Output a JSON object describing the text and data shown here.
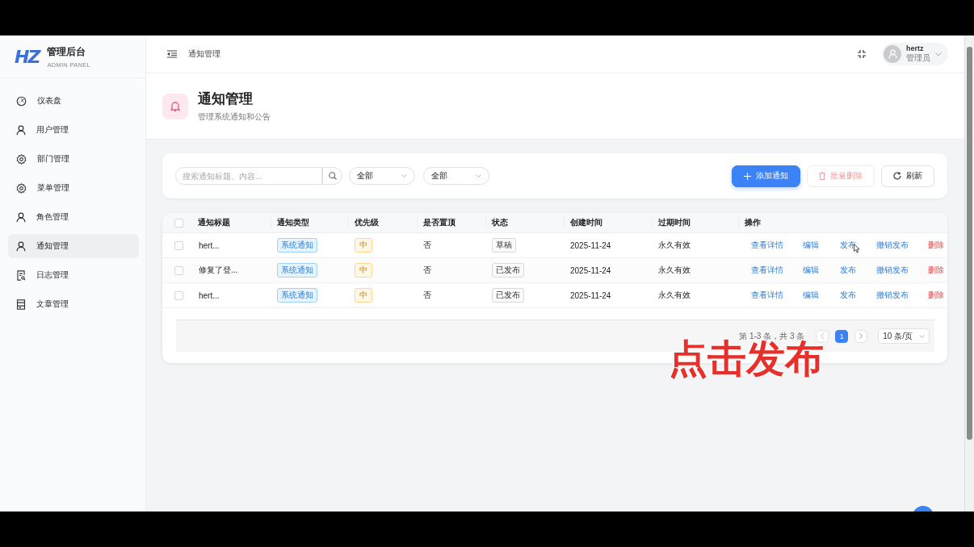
{
  "brand": {
    "logo": "HZ",
    "title": "管理后台",
    "subtitle": "ADMIN PANEL"
  },
  "sidebar": {
    "items": [
      {
        "label": "仪表盘",
        "kind": "dashboard",
        "selected": false
      },
      {
        "label": "用户管理",
        "kind": "user",
        "selected": false
      },
      {
        "label": "部门管理",
        "kind": "gear",
        "selected": false
      },
      {
        "label": "菜单管理",
        "kind": "gear",
        "selected": false
      },
      {
        "label": "角色管理",
        "kind": "user",
        "selected": false
      },
      {
        "label": "通知管理",
        "kind": "user",
        "selected": true
      },
      {
        "label": "日志管理",
        "kind": "log",
        "selected": false
      },
      {
        "label": "文章管理",
        "kind": "article",
        "selected": false
      }
    ]
  },
  "header": {
    "breadcrumb": "通知管理",
    "user": {
      "name": "hertz",
      "role": "管理员"
    }
  },
  "page": {
    "title": "通知管理",
    "subtitle": "管理系统通知和公告"
  },
  "toolbar": {
    "search": {
      "placeholder": "搜索通知标题、内容..."
    },
    "filters": [
      {
        "value": "全部"
      },
      {
        "value": "全部"
      }
    ],
    "buttons": [
      {
        "label": "添加通知",
        "kind": "primary",
        "disabled": false
      },
      {
        "label": "批量删除",
        "kind": "danger",
        "disabled": true
      },
      {
        "label": "刷新",
        "kind": "default",
        "disabled": false
      }
    ]
  },
  "table": {
    "select_all_checked": false,
    "columns": [
      "通知标题",
      "通知类型",
      "优先级",
      "是否置顶",
      "状态",
      "创建时间",
      "过期时间",
      "操作"
    ],
    "rows": [
      {
        "checked": false,
        "title": "hert...",
        "type": "系统通知",
        "priority": "中",
        "pinned": "否",
        "status": "草稿",
        "created": "2025-11-24",
        "expires": "永久有效",
        "actions": [
          {
            "label": "查看详情",
            "kind": "link"
          },
          {
            "label": "编辑",
            "kind": "link"
          },
          {
            "label": "发布",
            "kind": "link"
          },
          {
            "label": "撤销发布",
            "kind": "link"
          },
          {
            "label": "删除",
            "kind": "danger"
          }
        ]
      },
      {
        "checked": false,
        "title": "修复了登...",
        "type": "系统通知",
        "priority": "中",
        "pinned": "否",
        "status": "已发布",
        "created": "2025-11-24",
        "expires": "永久有效",
        "actions": [
          {
            "label": "查看详情",
            "kind": "link"
          },
          {
            "label": "编辑",
            "kind": "link"
          },
          {
            "label": "发布",
            "kind": "link"
          },
          {
            "label": "撤销发布",
            "kind": "link"
          },
          {
            "label": "删除",
            "kind": "danger"
          }
        ]
      },
      {
        "checked": false,
        "title": "hert...",
        "type": "系统通知",
        "priority": "中",
        "pinned": "否",
        "status": "已发布",
        "created": "2025-11-24",
        "expires": "永久有效",
        "actions": [
          {
            "label": "查看详情",
            "kind": "link"
          },
          {
            "label": "编辑",
            "kind": "link"
          },
          {
            "label": "发布",
            "kind": "link"
          },
          {
            "label": "撤销发布",
            "kind": "link"
          },
          {
            "label": "删除",
            "kind": "danger"
          }
        ]
      }
    ]
  },
  "pagination": {
    "summary": "第 1-3 条，共 3 条",
    "pages": [
      {
        "label": "1",
        "selected": true
      }
    ],
    "page_size": "10 条/页"
  },
  "caption": "点击发布"
}
